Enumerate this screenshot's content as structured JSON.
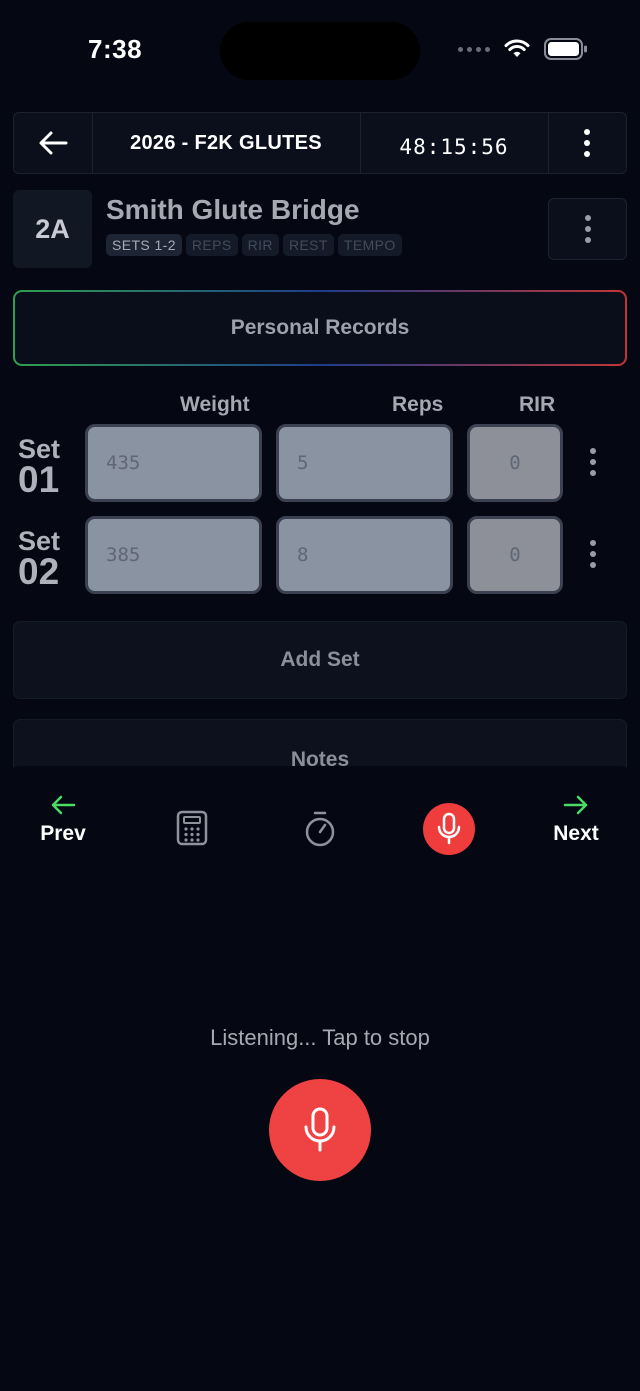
{
  "status_bar": {
    "time": "7:38"
  },
  "header": {
    "title": "2026 - F2K GLUTES",
    "timer": "48:15:56"
  },
  "exercise": {
    "badge": "2A",
    "title": "Smith Glute Bridge",
    "tags": [
      {
        "label": "SETS 1-2",
        "active": true
      },
      {
        "label": "REPS",
        "active": false
      },
      {
        "label": "RIR",
        "active": false
      },
      {
        "label": "REST",
        "active": false
      },
      {
        "label": "TEMPO",
        "active": false
      }
    ]
  },
  "personal_records": {
    "label": "Personal Records"
  },
  "columns": {
    "weight": "Weight",
    "reps": "Reps",
    "rir": "RIR"
  },
  "sets": [
    {
      "set_word": "Set",
      "number": "01",
      "weight_placeholder": "435",
      "reps_placeholder": "5",
      "rir_placeholder": "0"
    },
    {
      "set_word": "Set",
      "number": "02",
      "weight_placeholder": "385",
      "reps_placeholder": "8",
      "rir_placeholder": "0"
    }
  ],
  "add_set": {
    "label": "Add Set"
  },
  "notes": {
    "label": "Notes"
  },
  "bottom_nav": {
    "prev": "Prev",
    "next": "Next"
  },
  "voice": {
    "status": "Listening... Tap to stop"
  },
  "colors": {
    "accent_green": "#4cd964",
    "mic_red": "#ef4343",
    "background": "#050813"
  }
}
